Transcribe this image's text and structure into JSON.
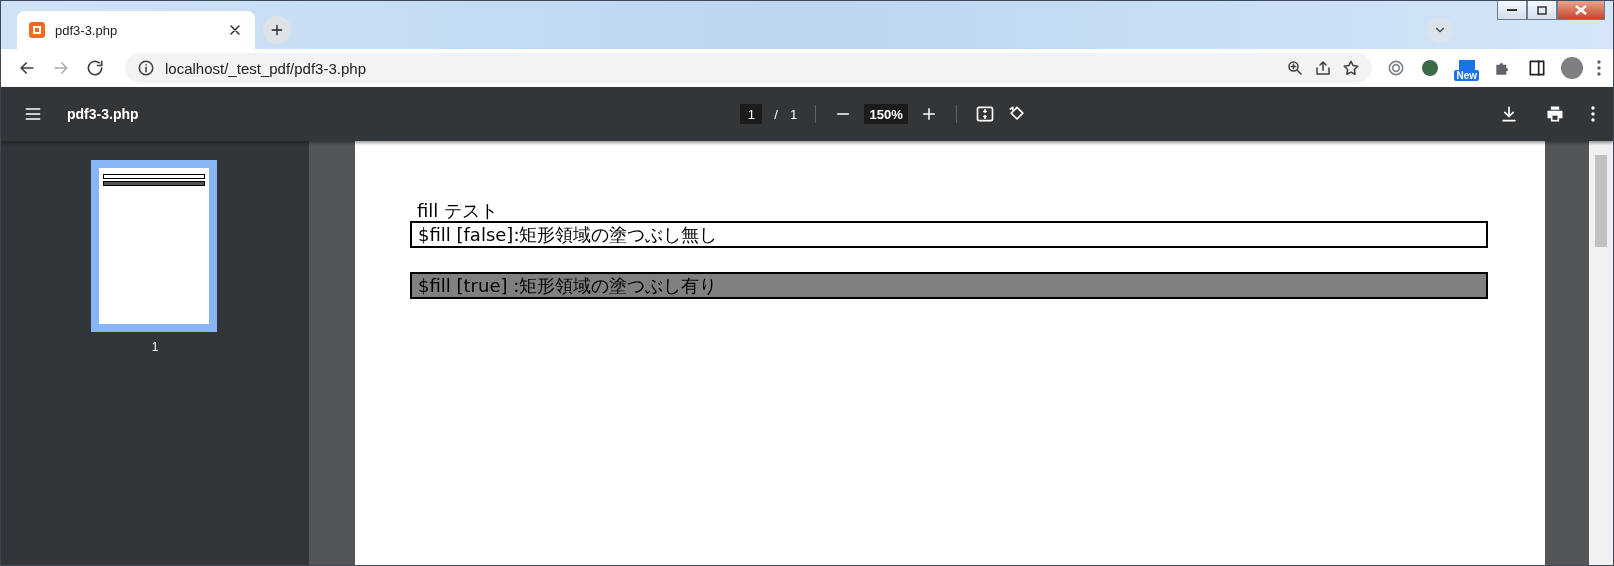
{
  "browser_tab": {
    "title": "pdf3-3.php",
    "selected": true
  },
  "address_bar": {
    "url": "localhost/_test_pdf/pdf3-3.php"
  },
  "extension_badge": "New",
  "pdf_toolbar": {
    "title": "pdf3-3.php",
    "page": "1",
    "separator": "/",
    "page_count": "1",
    "zoom": "150%"
  },
  "thumbnails": [
    {
      "label": "1",
      "selected": true
    }
  ],
  "document": {
    "heading": "fill テスト",
    "cells": [
      {
        "text": "$fill [false]:矩形領域の塗つぶし無し",
        "filled": false
      },
      {
        "text": "$fill [true] :矩形領域の塗つぶし有り",
        "filled": true
      }
    ]
  }
}
